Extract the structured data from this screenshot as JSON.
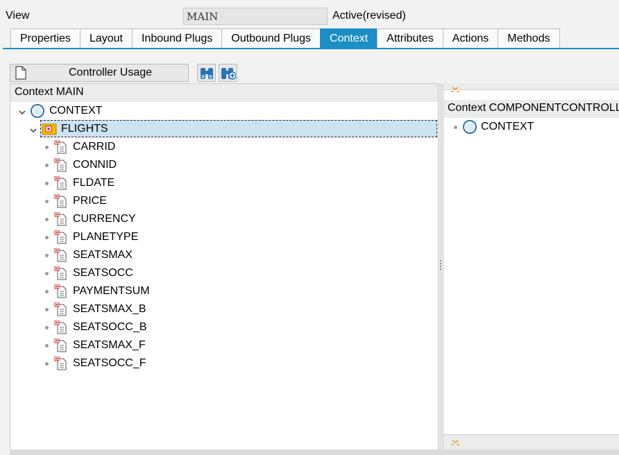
{
  "header": {
    "view_label": "View",
    "view_value": "MAIN",
    "status": "Active(revised)"
  },
  "tabs": [
    {
      "label": "Properties",
      "active": false
    },
    {
      "label": "Layout",
      "active": false
    },
    {
      "label": "Inbound Plugs",
      "active": false
    },
    {
      "label": "Outbound Plugs",
      "active": false
    },
    {
      "label": "Context",
      "active": true
    },
    {
      "label": "Attributes",
      "active": false
    },
    {
      "label": "Actions",
      "active": false
    },
    {
      "label": "Methods",
      "active": false
    }
  ],
  "toolbar": {
    "controller_usage_label": "Controller Usage",
    "icons": [
      "document-icon",
      "binoculars-icon",
      "binoculars-add-icon"
    ]
  },
  "left_panel": {
    "title": "Context MAIN",
    "root": "CONTEXT",
    "node": "FLIGHTS",
    "attributes": [
      "CARRID",
      "CONNID",
      "FLDATE",
      "PRICE",
      "CURRENCY",
      "PLANETYPE",
      "SEATSMAX",
      "SEATSOCC",
      "PAYMENTSUM",
      "SEATSMAX_B",
      "SEATSOCC_B",
      "SEATSMAX_F",
      "SEATSOCC_F"
    ]
  },
  "right_panel": {
    "title": "Context COMPONENTCONTROLLER",
    "root": "CONTEXT"
  },
  "colors": {
    "accent": "#1a8ec5",
    "selection": "#cce4f2",
    "node_folder": "#f5b800",
    "node_marker": "#d32020"
  }
}
